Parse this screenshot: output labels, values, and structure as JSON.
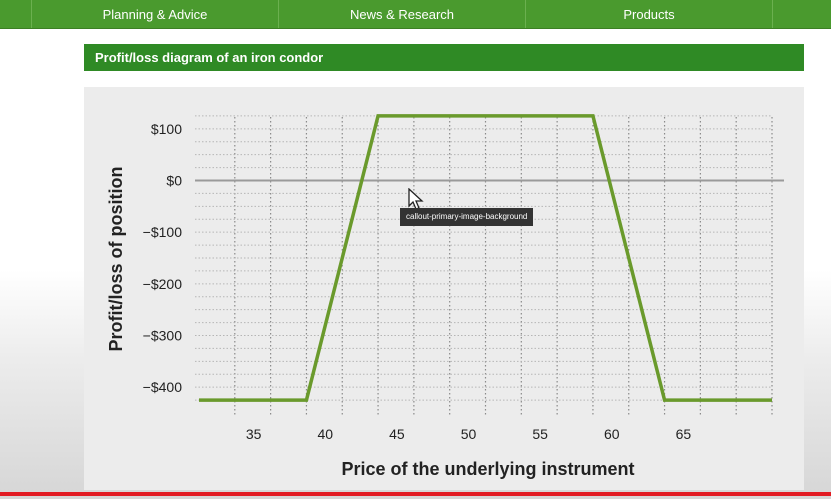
{
  "nav": {
    "items": [
      "Planning & Advice",
      "News & Research",
      "Products"
    ]
  },
  "banner": {
    "title": "Profit/loss diagram of an iron condor"
  },
  "tooltip": {
    "text": "callout-primary-image-background"
  },
  "colors": {
    "nav_bg": "#4a9a2e",
    "banner_bg": "#2f8a25",
    "line": "#6a9a2c",
    "zero_line": "#9a9a9a",
    "bottom_accent": "#e21b23"
  },
  "chart_data": {
    "type": "line",
    "xlabel": "Price of the underlying instrument",
    "ylabel": "Profit/loss of position",
    "xticks": [
      35,
      40,
      45,
      50,
      55,
      60,
      65
    ],
    "xtick_labels": [
      "35",
      "40",
      "45",
      "50",
      "55",
      "60",
      "65"
    ],
    "yticks": [
      100,
      0,
      -100,
      -200,
      -300,
      -400
    ],
    "ytick_labels": [
      "$100",
      "$0",
      "−$100",
      "−$200",
      "−$300",
      "−$400"
    ],
    "xlim": [
      30,
      70
    ],
    "ylim": [
      -450,
      150
    ],
    "grid": true,
    "series": [
      {
        "x": [
          30,
          37.5,
          42.5,
          57.5,
          62.5,
          70
        ],
        "y": [
          -425,
          -425,
          125,
          125,
          -425,
          -425
        ]
      }
    ]
  }
}
